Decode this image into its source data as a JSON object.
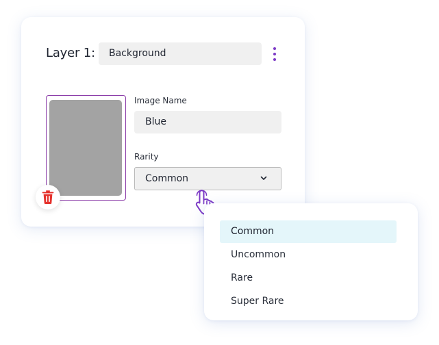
{
  "layer": {
    "label": "Layer 1:",
    "name_value": "Background",
    "menu_icon": "more-vertical-icon"
  },
  "image": {
    "placeholder_color": "#a3a3a3",
    "delete_icon": "trash-icon"
  },
  "image_name": {
    "label": "Image Name",
    "value": "Blue"
  },
  "rarity": {
    "label": "Rarity",
    "value": "Common",
    "chevron_icon": "chevron-down-icon",
    "options": [
      {
        "label": "Common",
        "selected": true
      },
      {
        "label": "Uncommon",
        "selected": false
      },
      {
        "label": "Rare",
        "selected": false
      },
      {
        "label": "Super Rare",
        "selected": false
      }
    ]
  },
  "cursor_icon": "hand-pointer-icon",
  "colors": {
    "accent": "#7d3bc6",
    "frame": "#8c3ea9",
    "danger": "#e5322d",
    "selected_bg": "#e4f6fa",
    "field_bg": "#f0f0f0"
  }
}
